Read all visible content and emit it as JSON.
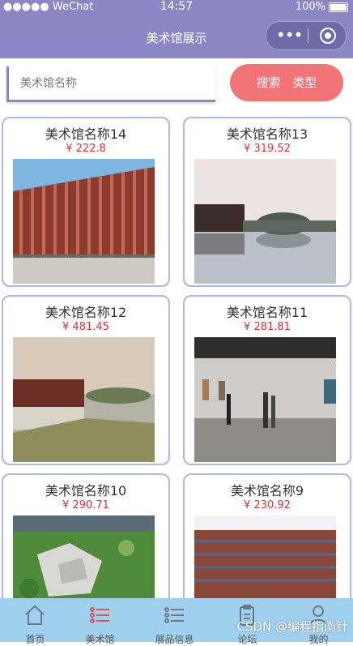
{
  "status": {
    "carrier": "●●●●● WeChat",
    "time": "14:57",
    "battery": "100%"
  },
  "nav": {
    "title": "美术馆展示"
  },
  "search": {
    "placeholder": "美术馆名称",
    "search_label": "搜索",
    "type_label": "类型"
  },
  "cards": [
    {
      "name": "美术馆名称14",
      "price": "¥ 222.8"
    },
    {
      "name": "美术馆名称13",
      "price": "¥ 319.52"
    },
    {
      "name": "美术馆名称12",
      "price": "¥ 481.45"
    },
    {
      "name": "美术馆名称11",
      "price": "¥ 281.81"
    },
    {
      "name": "美术馆名称10",
      "price": "¥ 290.71"
    },
    {
      "name": "美术馆名称9",
      "price": "¥ 230.92"
    }
  ],
  "tabs": [
    {
      "label": "首页",
      "icon": "home-icon"
    },
    {
      "label": "美术馆",
      "icon": "list-icon"
    },
    {
      "label": "展品信息",
      "icon": "list-icon"
    },
    {
      "label": "论坛",
      "icon": "clipboard-icon"
    },
    {
      "label": "我的",
      "icon": "person-icon"
    }
  ],
  "watermark": "CSDN @编程指南针",
  "colors": {
    "header": "#8c87c4",
    "accent": "#f17476",
    "price": "#e0303a",
    "tabbar": "#9fd0ee",
    "card_border": "#aeb6ea"
  }
}
